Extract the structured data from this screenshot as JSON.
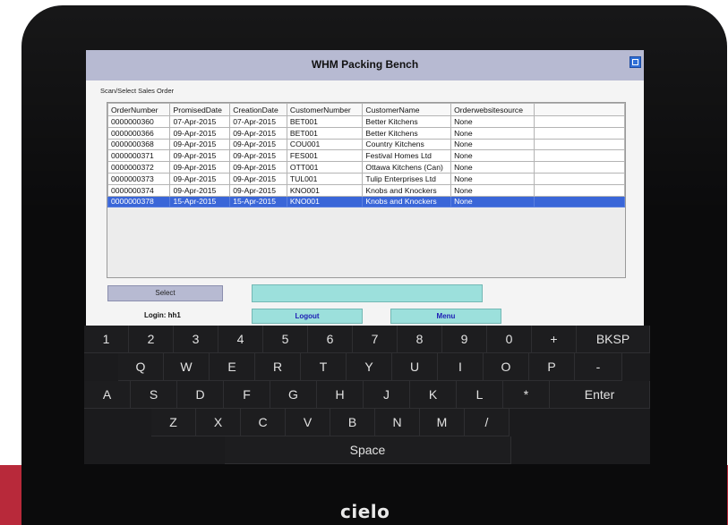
{
  "window": {
    "title": "WHM Packing Bench"
  },
  "labels": {
    "scan_select": "Scan/Select Sales Order",
    "login": "Login: hh1"
  },
  "buttons": {
    "select": "Select",
    "logout": "Logout",
    "menu": "Menu"
  },
  "scan_input": {
    "value": ""
  },
  "table": {
    "columns": [
      "OrderNumber",
      "PromisedDate",
      "CreationDate",
      "CustomerNumber",
      "CustomerName",
      "Orderwebsitesource"
    ],
    "rows": [
      [
        "0000000360",
        "07-Apr-2015",
        "07-Apr-2015",
        "BET001",
        "Better Kitchens",
        "None"
      ],
      [
        "0000000366",
        "09-Apr-2015",
        "09-Apr-2015",
        "BET001",
        "Better Kitchens",
        "None"
      ],
      [
        "0000000368",
        "09-Apr-2015",
        "09-Apr-2015",
        "COU001",
        "Country Kitchens",
        "None"
      ],
      [
        "0000000371",
        "09-Apr-2015",
        "09-Apr-2015",
        "FES001",
        "Festival Homes Ltd",
        "None"
      ],
      [
        "0000000372",
        "09-Apr-2015",
        "09-Apr-2015",
        "OTT001",
        "Ottawa Kitchens (Can)",
        "None"
      ],
      [
        "0000000373",
        "09-Apr-2015",
        "09-Apr-2015",
        "TUL001",
        "Tulip Enterprises Ltd",
        "None"
      ],
      [
        "0000000374",
        "09-Apr-2015",
        "09-Apr-2015",
        "KNO001",
        "Knobs and Knockers",
        "None"
      ],
      [
        "0000000378",
        "15-Apr-2015",
        "15-Apr-2015",
        "KNO001",
        "Knobs and Knockers",
        "None"
      ]
    ],
    "selected_row": 7
  },
  "keyboard": {
    "rows": [
      [
        "1",
        "2",
        "3",
        "4",
        "5",
        "6",
        "7",
        "8",
        "9",
        "0",
        "+",
        "BKSP"
      ],
      [
        "Q",
        "W",
        "E",
        "R",
        "T",
        "Y",
        "U",
        "I",
        "O",
        "P",
        "-"
      ],
      [
        "A",
        "S",
        "D",
        "F",
        "G",
        "H",
        "J",
        "K",
        "L",
        "*",
        "Enter"
      ],
      [
        "Z",
        "X",
        "C",
        "V",
        "B",
        "N",
        "M",
        "/"
      ],
      [
        "Space"
      ]
    ]
  },
  "device": {
    "brand": "cielo"
  },
  "colors": {
    "titlebar": "#b7bad2",
    "selection": "#3a66d8",
    "accent_button": "#9ce0dc",
    "brand_bar": "#b8293a"
  }
}
